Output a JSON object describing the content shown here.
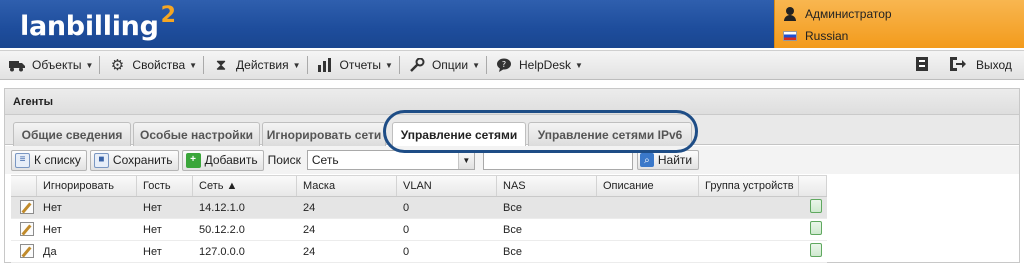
{
  "app": {
    "logo_text": "lanbilling",
    "logo_sup": "2"
  },
  "user": {
    "name": "Администратор",
    "language": "Russian"
  },
  "toolbar": {
    "items": [
      {
        "label": "Объекты",
        "icon": "truck-icon"
      },
      {
        "label": "Свойства",
        "icon": "gear-icon"
      },
      {
        "label": "Действия",
        "icon": "hourglass-icon"
      },
      {
        "label": "Отчеты",
        "icon": "bar-chart-icon"
      },
      {
        "label": "Опции",
        "icon": "wrench-icon"
      },
      {
        "label": "HelpDesk",
        "icon": "chat-bubble-icon"
      }
    ],
    "logout_label": "Выход"
  },
  "panel": {
    "title": "Агенты",
    "tabs": [
      "Общие сведения",
      "Особые настройки",
      "Игнорировать сети",
      "Управление сетями",
      "Управление сетями IPv6"
    ],
    "active_tab": 3
  },
  "actions": {
    "to_list": "К списку",
    "save": "Сохранить",
    "add": "Добавить",
    "search_label": "Поиск",
    "search_field_value": "Сеть",
    "search_input_value": "",
    "find": "Найти"
  },
  "grid": {
    "columns": [
      "",
      "Игнорировать",
      "Гость",
      "Сеть ▲",
      "Маска",
      "VLAN",
      "NAS",
      "Описание",
      "Группа устройств",
      ""
    ],
    "rows": [
      [
        "Нет",
        "Нет",
        "14.12.1.0",
        "24",
        "0",
        "Все",
        "",
        ""
      ],
      [
        "Нет",
        "Нет",
        "50.12.2.0",
        "24",
        "0",
        "Все",
        "",
        ""
      ],
      [
        "Да",
        "Нет",
        "127.0.0.0",
        "24",
        "0",
        "Все",
        "",
        ""
      ]
    ]
  },
  "colors": {
    "header_blue": "#1e4d9c",
    "user_orange": "#f5a623",
    "highlight_ring": "#1e4d86"
  }
}
